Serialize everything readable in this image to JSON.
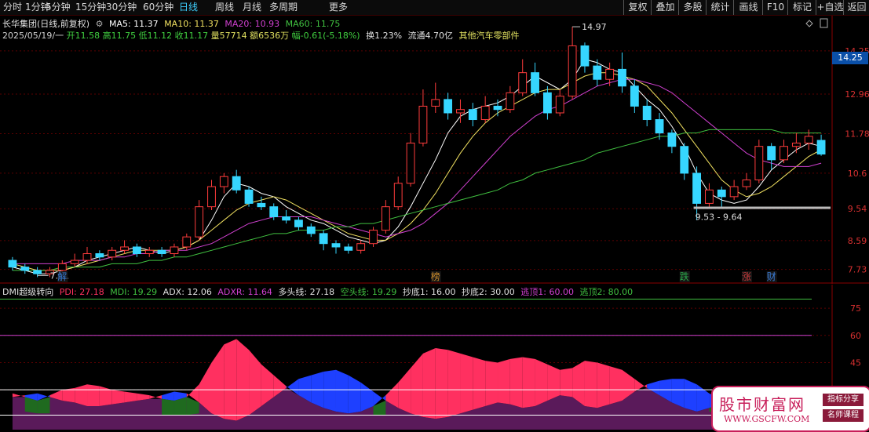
{
  "toolbar": {
    "periods": [
      {
        "label": "分时",
        "active": false
      },
      {
        "label": "1分钟",
        "active": false
      },
      {
        "label": "5分钟",
        "active": false
      },
      {
        "label": "15分钟",
        "active": false
      },
      {
        "label": "30分钟",
        "active": false
      },
      {
        "label": "60分钟",
        "active": false
      },
      {
        "label": "日线",
        "active": true
      },
      {
        "label": "周线",
        "active": false
      },
      {
        "label": "月线",
        "active": false
      },
      {
        "label": "多周期",
        "active": false
      },
      {
        "label": "更多",
        "active": false
      }
    ],
    "right_buttons": [
      "复权",
      "叠加",
      "多股",
      "统计",
      "画线",
      "F10",
      "标记",
      "+自选",
      "返回"
    ]
  },
  "header": {
    "stock": "长华集团(日线,前复权)",
    "ma5": "MA5: 11.37",
    "ma10": "MA10: 11.37",
    "ma20": "MA20: 10.93",
    "ma60": "MA60: 11.75",
    "date": "2025/05/19/一",
    "open": "开11.58",
    "high": "高11.75",
    "low": "低11.12",
    "close": "收11.17",
    "volume": "量57714",
    "amount": "额6536万",
    "change": "幅-0.61(-5.18%)",
    "turnover": "换1.23%",
    "float": "流通4.70亿",
    "sector": "其他汽车零部件"
  },
  "indicator_header": {
    "name": "DMI超级转向",
    "pdi": "PDI: 27.18",
    "mdi": "MDI: 19.29",
    "adx": "ADX: 12.06",
    "adxr": "ADXR: 11.64",
    "bull": "多头线: 27.18",
    "bear": "空头线: 19.29",
    "bottom1": "抄底1: 16.00",
    "bottom2": "抄底2: 30.00",
    "top1": "逃顶1: 60.00",
    "top2": "逃顶2: 80.00"
  },
  "current_price": "14.25",
  "annotations": {
    "high_label": "14.97",
    "low_label": "7.51",
    "range_label": "9.53 - 9.64"
  },
  "event_markers": [
    {
      "text": "解",
      "color": "#3a7dd8"
    },
    {
      "text": "榜",
      "color": "#c98a2a"
    },
    {
      "text": "跌",
      "color": "#2aa84a"
    },
    {
      "text": "涨",
      "color": "#c83a3a"
    },
    {
      "text": "财",
      "color": "#3a7dd8"
    }
  ],
  "watermark": {
    "title": "股市财富网",
    "url": "WWW.GSCFW.COM",
    "tag1": "指标分享",
    "tag2": "名师课程"
  },
  "colors": {
    "up": "#ff3c3c",
    "down": "#36d6ff",
    "ma5": "#ffffff",
    "ma10": "#f0e060",
    "ma20": "#d040d0",
    "ma60": "#40c040",
    "pdi": "#ff3060",
    "mdi": "#1e40ff",
    "adx": "#3a8a2a",
    "adxr": "#5a1a5a"
  },
  "chart_data": [
    {
      "type": "candlestick",
      "title": "长华集团(日线,前复权)",
      "y_axis_ticks": [
        14.25,
        12.96,
        11.78,
        10.6,
        9.54,
        8.59,
        7.73
      ],
      "ylim": [
        7.3,
        15.3
      ],
      "grid": true,
      "series": [
        {
          "name": "MA5",
          "values": [
            7.8,
            7.7,
            7.6,
            7.6,
            7.7,
            7.8,
            8.0,
            8.1,
            8.2,
            8.3,
            8.4,
            8.3,
            8.2,
            8.3,
            8.4,
            8.6,
            9.2,
            9.9,
            10.3,
            10.2,
            10.0,
            9.9,
            9.6,
            9.4,
            9.2,
            9.1,
            8.9,
            8.7,
            8.6,
            8.5,
            8.6,
            9.0,
            9.6,
            10.3,
            11.0,
            11.8,
            12.3,
            12.5,
            12.6,
            12.7,
            12.9,
            13.2,
            13.5,
            13.3,
            13.1,
            13.4,
            14.0,
            13.9,
            13.7,
            13.6,
            13.2,
            12.8,
            12.5,
            12.0,
            11.4,
            10.6,
            10.0,
            9.8,
            9.7,
            9.8,
            10.2,
            10.7,
            11.0,
            11.3,
            11.5,
            11.4
          ]
        },
        {
          "name": "MA10",
          "values": [
            7.9,
            7.8,
            7.7,
            7.7,
            7.7,
            7.8,
            7.9,
            8.0,
            8.1,
            8.2,
            8.3,
            8.3,
            8.3,
            8.3,
            8.4,
            8.6,
            8.9,
            9.2,
            9.5,
            9.7,
            9.8,
            9.9,
            9.8,
            9.6,
            9.4,
            9.2,
            9.0,
            8.8,
            8.7,
            8.6,
            8.6,
            8.8,
            9.1,
            9.5,
            10.0,
            10.6,
            11.2,
            11.7,
            12.1,
            12.4,
            12.6,
            12.8,
            13.0,
            13.1,
            13.1,
            13.3,
            13.5,
            13.6,
            13.6,
            13.5,
            13.4,
            13.2,
            12.8,
            12.4,
            11.9,
            11.4,
            10.9,
            10.4,
            10.1,
            9.9,
            10.0,
            10.2,
            10.5,
            10.8,
            11.1,
            11.3
          ]
        },
        {
          "name": "MA20",
          "values": [
            7.9,
            7.9,
            7.9,
            7.9,
            7.9,
            8.0,
            8.0,
            8.0,
            8.1,
            8.1,
            8.2,
            8.2,
            8.3,
            8.3,
            8.3,
            8.4,
            8.5,
            8.7,
            8.9,
            9.1,
            9.2,
            9.3,
            9.3,
            9.3,
            9.3,
            9.2,
            9.1,
            9.0,
            8.9,
            8.8,
            8.7,
            8.8,
            8.9,
            9.1,
            9.4,
            9.7,
            10.1,
            10.5,
            10.9,
            11.3,
            11.7,
            12.0,
            12.3,
            12.5,
            12.6,
            12.8,
            13.0,
            13.2,
            13.3,
            13.4,
            13.4,
            13.3,
            13.2,
            13.0,
            12.7,
            12.4,
            12.1,
            11.8,
            11.5,
            11.2,
            11.0,
            10.9,
            10.8,
            10.8,
            10.8,
            10.9
          ]
        },
        {
          "name": "MA60",
          "values": [
            7.7,
            7.7,
            7.7,
            7.7,
            7.8,
            7.8,
            7.8,
            7.8,
            7.9,
            7.9,
            7.9,
            8.0,
            8.0,
            8.1,
            8.1,
            8.2,
            8.3,
            8.4,
            8.5,
            8.6,
            8.7,
            8.8,
            8.8,
            8.9,
            8.9,
            8.9,
            9.0,
            9.0,
            9.1,
            9.1,
            9.2,
            9.3,
            9.4,
            9.5,
            9.6,
            9.7,
            9.8,
            9.9,
            10.0,
            10.1,
            10.3,
            10.4,
            10.6,
            10.7,
            10.8,
            10.9,
            11.0,
            11.2,
            11.3,
            11.4,
            11.5,
            11.6,
            11.7,
            11.7,
            11.8,
            11.8,
            11.9,
            11.9,
            11.9,
            11.9,
            11.9,
            11.9,
            11.8,
            11.8,
            11.8,
            11.8
          ]
        }
      ],
      "candles": [
        [
          8.0,
          7.8,
          8.1,
          7.7
        ],
        [
          7.8,
          7.7,
          7.9,
          7.6
        ],
        [
          7.7,
          7.6,
          7.8,
          7.5
        ],
        [
          7.6,
          7.7,
          7.8,
          7.5
        ],
        [
          7.7,
          7.9,
          8.0,
          7.6
        ],
        [
          7.9,
          8.0,
          8.2,
          7.8
        ],
        [
          8.0,
          8.2,
          8.4,
          7.9
        ],
        [
          8.2,
          8.1,
          8.3,
          8.0
        ],
        [
          8.1,
          8.3,
          8.4,
          8.0
        ],
        [
          8.3,
          8.4,
          8.6,
          8.2
        ],
        [
          8.4,
          8.2,
          8.5,
          8.1
        ],
        [
          8.2,
          8.3,
          8.4,
          8.1
        ],
        [
          8.3,
          8.2,
          8.4,
          8.1
        ],
        [
          8.2,
          8.4,
          8.5,
          8.1
        ],
        [
          8.4,
          8.7,
          8.8,
          8.3
        ],
        [
          8.7,
          9.6,
          9.8,
          8.6
        ],
        [
          9.6,
          10.2,
          10.4,
          9.5
        ],
        [
          10.2,
          10.5,
          10.6,
          10.0
        ],
        [
          10.5,
          10.1,
          10.7,
          10.0
        ],
        [
          10.1,
          9.7,
          10.2,
          9.6
        ],
        [
          9.7,
          9.6,
          9.9,
          9.5
        ],
        [
          9.6,
          9.3,
          9.7,
          9.2
        ],
        [
          9.3,
          9.2,
          9.5,
          9.1
        ],
        [
          9.2,
          9.0,
          9.3,
          8.9
        ],
        [
          9.0,
          8.8,
          9.1,
          8.7
        ],
        [
          8.8,
          8.5,
          8.9,
          8.3
        ],
        [
          8.5,
          8.4,
          8.6,
          8.2
        ],
        [
          8.4,
          8.3,
          8.5,
          8.2
        ],
        [
          8.3,
          8.5,
          8.6,
          8.2
        ],
        [
          8.5,
          8.9,
          9.0,
          8.4
        ],
        [
          8.9,
          9.6,
          9.8,
          8.8
        ],
        [
          9.6,
          10.3,
          10.5,
          9.5
        ],
        [
          10.3,
          11.5,
          11.8,
          10.2
        ],
        [
          11.5,
          12.6,
          13.1,
          11.4
        ],
        [
          12.6,
          12.8,
          13.3,
          12.4
        ],
        [
          12.8,
          12.4,
          13.0,
          12.2
        ],
        [
          12.4,
          12.5,
          12.8,
          12.1
        ],
        [
          12.5,
          12.2,
          12.7,
          12.0
        ],
        [
          12.2,
          12.6,
          12.9,
          12.1
        ],
        [
          12.6,
          12.5,
          12.8,
          12.3
        ],
        [
          12.5,
          13.0,
          13.2,
          12.4
        ],
        [
          13.0,
          13.6,
          14.0,
          12.9
        ],
        [
          13.6,
          13.0,
          13.9,
          12.9
        ],
        [
          13.0,
          12.4,
          13.2,
          12.2
        ],
        [
          12.4,
          12.9,
          13.1,
          12.3
        ],
        [
          12.9,
          14.4,
          14.97,
          12.8
        ],
        [
          14.4,
          13.8,
          14.5,
          13.6
        ],
        [
          13.8,
          13.4,
          14.0,
          13.2
        ],
        [
          13.4,
          13.7,
          13.9,
          13.2
        ],
        [
          13.7,
          13.2,
          14.2,
          13.0
        ],
        [
          13.2,
          12.6,
          13.4,
          12.4
        ],
        [
          12.6,
          12.2,
          12.8,
          12.0
        ],
        [
          12.2,
          11.8,
          12.4,
          11.6
        ],
        [
          11.8,
          11.4,
          11.9,
          11.2
        ],
        [
          11.4,
          10.6,
          11.5,
          10.4
        ],
        [
          10.6,
          9.7,
          10.8,
          9.2
        ],
        [
          9.7,
          10.1,
          10.3,
          9.6
        ],
        [
          10.1,
          9.9,
          10.2,
          9.6
        ],
        [
          9.9,
          10.2,
          10.4,
          9.8
        ],
        [
          10.2,
          10.4,
          10.6,
          10.1
        ],
        [
          10.4,
          11.4,
          11.6,
          10.3
        ],
        [
          11.4,
          11.0,
          11.5,
          10.7
        ],
        [
          11.0,
          11.4,
          11.6,
          10.9
        ],
        [
          11.4,
          11.5,
          11.8,
          11.2
        ],
        [
          11.5,
          11.7,
          11.9,
          11.3
        ],
        [
          11.58,
          11.17,
          11.75,
          11.12
        ]
      ]
    },
    {
      "type": "area",
      "title": "DMI超级转向",
      "y_axis_ticks": [
        75.0,
        60.0,
        45.0,
        30.0
      ],
      "ylim": [
        8,
        88
      ],
      "grid": true,
      "reference_lines": [
        80,
        60,
        30,
        16
      ],
      "series": [
        {
          "name": "PDI",
          "values": [
            28,
            26,
            24,
            27,
            30,
            31,
            33,
            32,
            30,
            29,
            28,
            27,
            25,
            24,
            26,
            33,
            45,
            55,
            58,
            52,
            44,
            38,
            32,
            27,
            23,
            20,
            18,
            17,
            18,
            21,
            27,
            34,
            42,
            50,
            53,
            52,
            50,
            48,
            46,
            45,
            47,
            48,
            47,
            44,
            41,
            42,
            46,
            45,
            43,
            41,
            36,
            31,
            27,
            23,
            20,
            18,
            20,
            22,
            25,
            27,
            28,
            28,
            27,
            27,
            27,
            27
          ]
        },
        {
          "name": "MDI",
          "values": [
            26,
            27,
            28,
            26,
            24,
            23,
            21,
            21,
            22,
            23,
            24,
            25,
            27,
            29,
            28,
            23,
            17,
            14,
            13,
            16,
            21,
            26,
            31,
            36,
            38,
            40,
            41,
            38,
            34,
            29,
            24,
            20,
            17,
            15,
            14,
            15,
            17,
            19,
            21,
            23,
            22,
            20,
            21,
            24,
            27,
            26,
            21,
            20,
            22,
            24,
            29,
            33,
            35,
            36,
            36,
            33,
            28,
            25,
            23,
            22,
            21,
            20,
            20,
            19,
            19,
            19
          ]
        },
        {
          "name": "ADX",
          "values": [
            18,
            18,
            17,
            17,
            16,
            16,
            17,
            17,
            17,
            17,
            16,
            16,
            16,
            16,
            16,
            17,
            20,
            24,
            27,
            28,
            27,
            25,
            22,
            19,
            16,
            14,
            14,
            15,
            16,
            16,
            16,
            17,
            20,
            23,
            26,
            28,
            29,
            29,
            28,
            27,
            26,
            25,
            25,
            24,
            23,
            23,
            24,
            25,
            25,
            24,
            23,
            22,
            21,
            20,
            20,
            19,
            18,
            17,
            16,
            15,
            14,
            13,
            13,
            12,
            12,
            12
          ]
        },
        {
          "name": "ADXR",
          "values": [
            19,
            19,
            19,
            18,
            18,
            17,
            17,
            17,
            17,
            17,
            17,
            17,
            17,
            16,
            16,
            16,
            17,
            19,
            21,
            23,
            24,
            25,
            25,
            24,
            22,
            20,
            18,
            17,
            16,
            15,
            15,
            15,
            16,
            18,
            20,
            23,
            25,
            27,
            28,
            28,
            28,
            27,
            26,
            25,
            24,
            24,
            24,
            24,
            24,
            24,
            24,
            24,
            23,
            22,
            21,
            20,
            19,
            18,
            17,
            16,
            15,
            14,
            13,
            13,
            12,
            12
          ]
        }
      ]
    }
  ]
}
